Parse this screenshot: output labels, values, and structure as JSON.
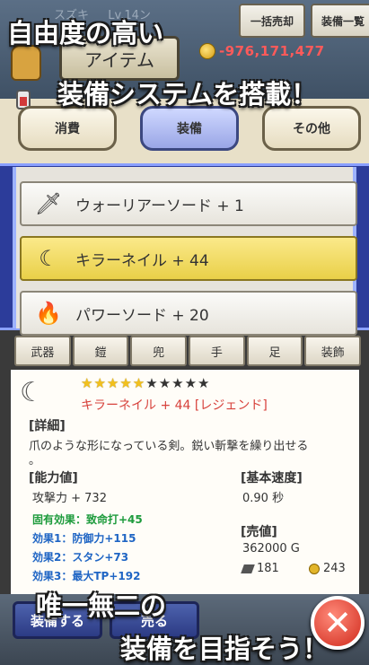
{
  "header": {
    "player_name": "スズキ 　 Lv.14ン",
    "sell_all_label": "一括売却",
    "equip_list_label": "装備一覧",
    "gold": "-976,171,477",
    "item_tab_label": "アイテム"
  },
  "promo": {
    "line1": "自由度の高い",
    "line2": "装備システムを搭載！",
    "line3": "唯一無二の",
    "line4": "装備を目指そう！"
  },
  "categories": [
    {
      "label": "消費",
      "active": false
    },
    {
      "label": "装備",
      "active": true
    },
    {
      "label": "その他",
      "active": false
    }
  ],
  "items": [
    {
      "name": "ウォーリアーソード + 1",
      "icon": "sword-icon",
      "selected": false
    },
    {
      "name": "キラーネイル + 44",
      "icon": "claw-icon",
      "selected": true
    },
    {
      "name": "パワーソード + 20",
      "icon": "flame-sword-icon",
      "selected": false
    }
  ],
  "slots": [
    "武器",
    "鎧",
    "兜",
    "手",
    "足",
    "装飾"
  ],
  "detail": {
    "stars_on": "★★★★★",
    "stars_off": "★★★★★",
    "name": "キラーネイル + 44 [レジェンド]",
    "detail_header": "[詳細]",
    "description": "爪のような形になっている剣。鋭い斬撃を繰り出せる",
    "description_tail": "。",
    "ability_header": "[能力値]",
    "attack": "攻撃力 + 732",
    "inherent": "固有効果：致命打+45",
    "effect1": "効果1：防御力+115",
    "effect2": "効果2：スタン+73",
    "effect3": "効果3：最大TP+192",
    "speed_header": "[基本速度]",
    "speed": "0.90 秒",
    "price_header": "[売値]",
    "price": "362000 G",
    "weight": "181",
    "coin_value": "243"
  },
  "bottom": {
    "equip_label": "装備する",
    "sell_label": "売る",
    "close": "✕"
  }
}
